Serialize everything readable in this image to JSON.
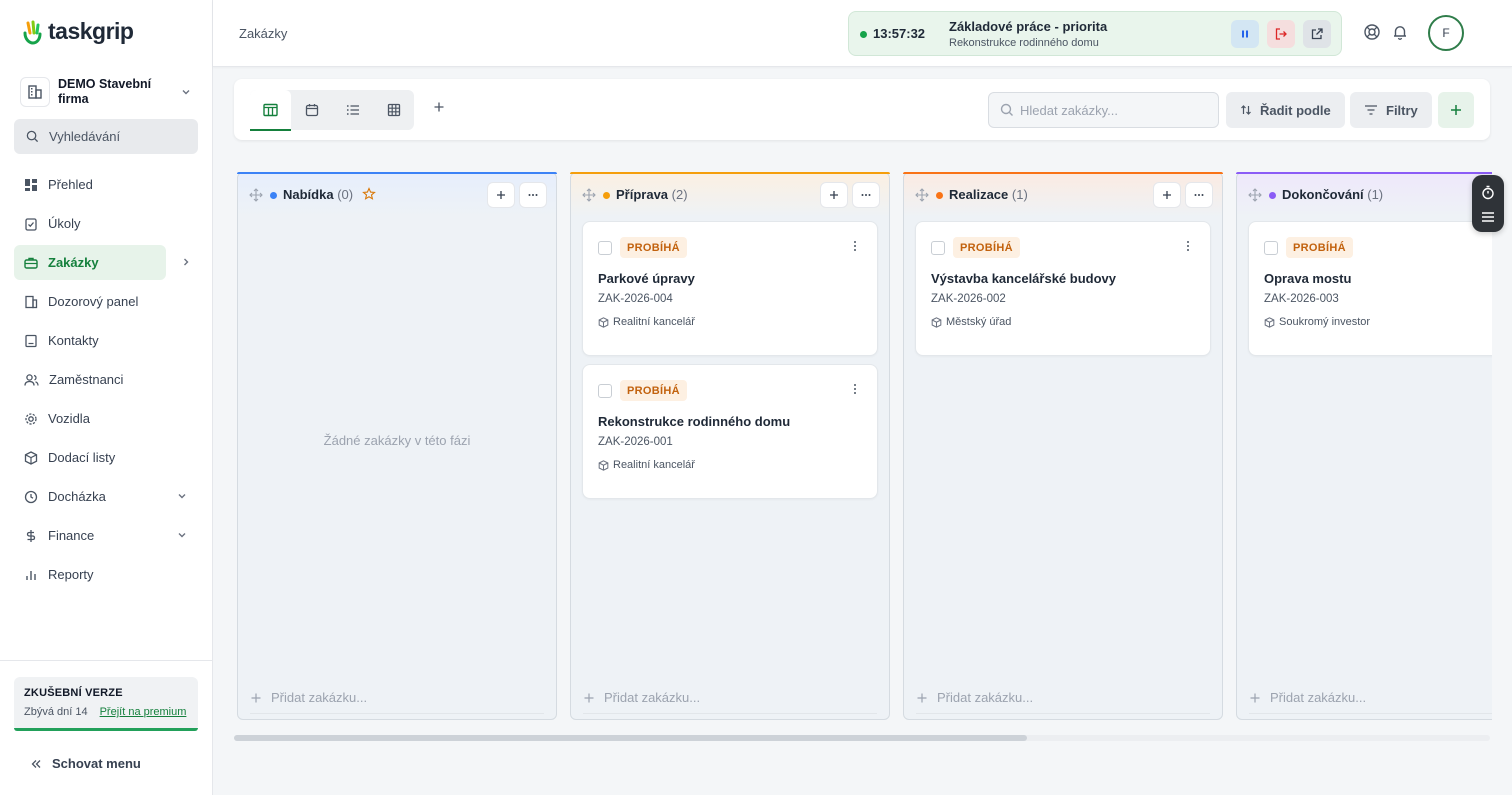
{
  "app": {
    "logo_text": "taskgrip",
    "company_name": "DEMO Stavební firma"
  },
  "sidebar": {
    "search_label": "Vyhledávání",
    "items": [
      {
        "label": "Přehled",
        "icon": "grid-icon"
      },
      {
        "label": "Úkoly",
        "icon": "clipboard-check-icon"
      },
      {
        "label": "Zakázky",
        "icon": "briefcase-icon",
        "active": true
      },
      {
        "label": "Dozorový panel",
        "icon": "building-icon"
      },
      {
        "label": "Kontakty",
        "icon": "address-book-icon"
      },
      {
        "label": "Zaměstnanci",
        "icon": "users-icon"
      },
      {
        "label": "Vozidla",
        "icon": "gear-icon"
      },
      {
        "label": "Dodací listy",
        "icon": "package-icon"
      },
      {
        "label": "Docházka",
        "icon": "clock-icon"
      },
      {
        "label": "Finance",
        "icon": "dollar-icon"
      },
      {
        "label": "Reporty",
        "icon": "bar-chart-icon"
      }
    ],
    "trial": {
      "title": "ZKUŠEBNÍ VERZE",
      "days_left": "Zbývá dní 14",
      "premium_link": "Přejít na premium"
    },
    "hide_menu": "Schovat menu"
  },
  "header": {
    "page_title": "Zakázky",
    "timer": {
      "time": "13:57:32",
      "task": "Základové práce - priorita",
      "project": "Rekonstrukce rodinného domu"
    },
    "avatar_initial": "F"
  },
  "toolbar": {
    "search_placeholder": "Hledat zakázky...",
    "sort_label": "Řadit podle",
    "filter_label": "Filtry"
  },
  "board": {
    "add_job_label": "Přidat zakázku...",
    "columns": [
      {
        "title": "Nabídka",
        "count": "(0)",
        "color": "#3b82f6",
        "empty_text": "Žádné zakázky v této fázi",
        "cards": []
      },
      {
        "title": "Příprava",
        "count": "(2)",
        "color": "#f59e0b",
        "cards": [
          {
            "status": "PROBÍHÁ",
            "title": "Parkové úpravy",
            "code": "ZAK-2026-004",
            "client": "Realitní kancelář"
          },
          {
            "status": "PROBÍHÁ",
            "title": "Rekonstrukce rodinného domu",
            "code": "ZAK-2026-001",
            "client": "Realitní kancelář"
          }
        ]
      },
      {
        "title": "Realizace",
        "count": "(1)",
        "color": "#f97316",
        "cards": [
          {
            "status": "PROBÍHÁ",
            "title": "Výstavba kancelářské budovy",
            "code": "ZAK-2026-002",
            "client": "Městský úřad"
          }
        ]
      },
      {
        "title": "Dokončování",
        "count": "(1)",
        "color": "#8b5cf6",
        "cards": [
          {
            "status": "PROBÍHÁ",
            "title": "Oprava mostu",
            "code": "ZAK-2026-003",
            "client": "Soukromý investor"
          }
        ]
      }
    ]
  }
}
